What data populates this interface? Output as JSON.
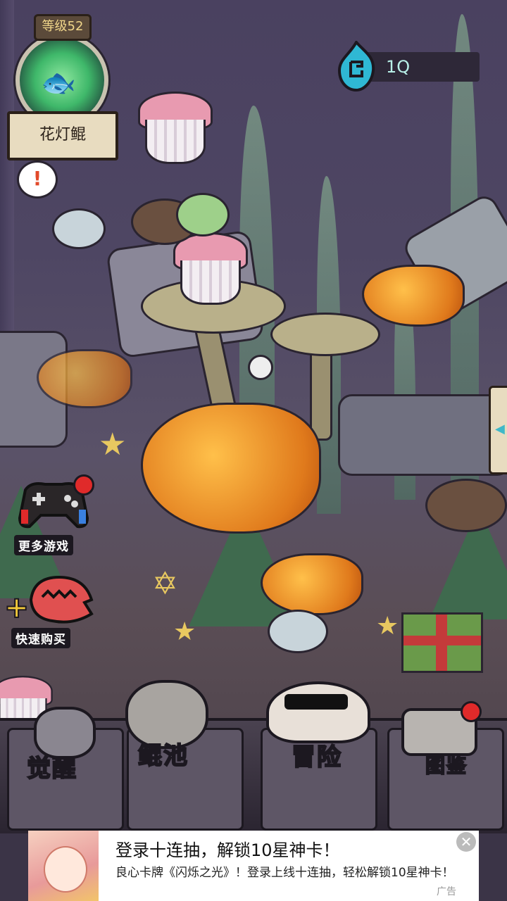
{
  "player": {
    "level_label": "等级52",
    "fish_name": "花灯鲲"
  },
  "currency": {
    "amount": "1Q",
    "icon": "gem-icon"
  },
  "side_buttons": {
    "more_games": "更多游戏",
    "quick_buy": "快速购买"
  },
  "bottom_menu": [
    {
      "label": "觉醒",
      "icon": "awaken-icon"
    },
    {
      "label": "鲲池",
      "icon": "fish-pond-icon"
    },
    {
      "label": "冒险",
      "icon": "adventure-skull-icon"
    },
    {
      "label": "图鉴",
      "icon": "scroll-icon"
    }
  ],
  "ad": {
    "title": "登录十连抽，解锁10星神卡！",
    "description": "良心卡牌《闪烁之光》！登录上线十连抽，轻松解锁10星神卡！",
    "tag": "广告",
    "close": "✕"
  },
  "colors": {
    "background": "#4e4663",
    "accent_gold": "#f2c93a",
    "alert_red": "#e02a2a",
    "currency_text": "#b8f0e8"
  }
}
